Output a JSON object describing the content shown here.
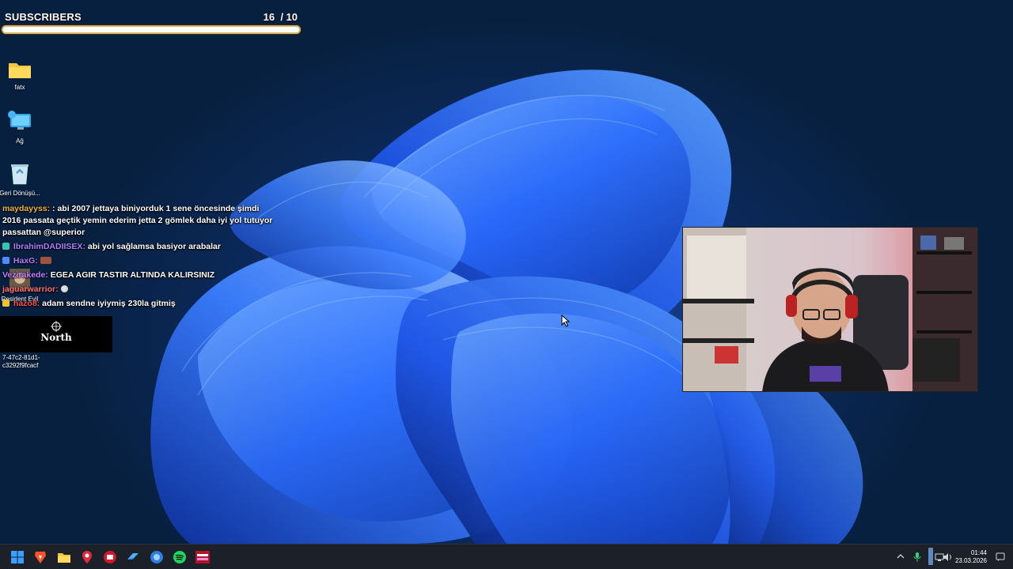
{
  "subscriber_goal": {
    "label": "SUBSCRIBERS",
    "current": "16",
    "goal_text": "/ 10",
    "progress_fraction": 1.0
  },
  "desktop_icons": [
    {
      "label": "fatx",
      "icon": "folder-icon"
    },
    {
      "label": "Ağ",
      "icon": "network-icon"
    },
    {
      "label": "Geri Dönüşü...",
      "icon": "recycle-bin-icon"
    },
    {
      "label": "Resident Evil",
      "icon": "game-icon"
    }
  ],
  "chat": [
    {
      "user": "maydayyss:",
      "user_color": "#f0b23a",
      "text": ": abi 2007 jettaya biniyorduk 1 sene öncesinde şimdi 2016 passata geçtik yemin ederim jetta 2 gömlek daha iyi yol tutuyor passattan @superior"
    },
    {
      "user": "IbrahimDADIISEX:",
      "user_color": "#b07cff",
      "text": "abi yol sağlamsa basiyor arabalar"
    },
    {
      "user": "HaxG:",
      "user_color": "#b07cff",
      "text": ""
    },
    {
      "user": "Vezirakede:",
      "user_color": "#c080ff",
      "text": "EGEA AGIR TASTIR ALTINDA KALIRSINIZ"
    },
    {
      "user": "jaguarwarrior:",
      "user_color": "#ff7070",
      "text": ""
    },
    {
      "user": "hazo8:",
      "user_color": "#ff5050",
      "text": "adam sendne iyiymiş 230la gitmiş"
    }
  ],
  "north_logo_text": "North",
  "file_id_text": "7-47c2-81d1-\nc3292f9fcacf",
  "taskbar": {
    "apps": [
      "windows-start-icon",
      "brave-browser-icon",
      "file-explorer-icon",
      "maps-pin-icon",
      "app-red-icon",
      "steam-icon",
      "app-blue-circle-icon",
      "spotify-icon",
      "app-thumbnail-icon"
    ],
    "time": "01:44",
    "date": "23.03.2026"
  },
  "colors": {
    "accent_gold": "#d7b36a",
    "taskbar_bg": "#1c2028",
    "wallpaper_blue": "#2a6cff"
  }
}
